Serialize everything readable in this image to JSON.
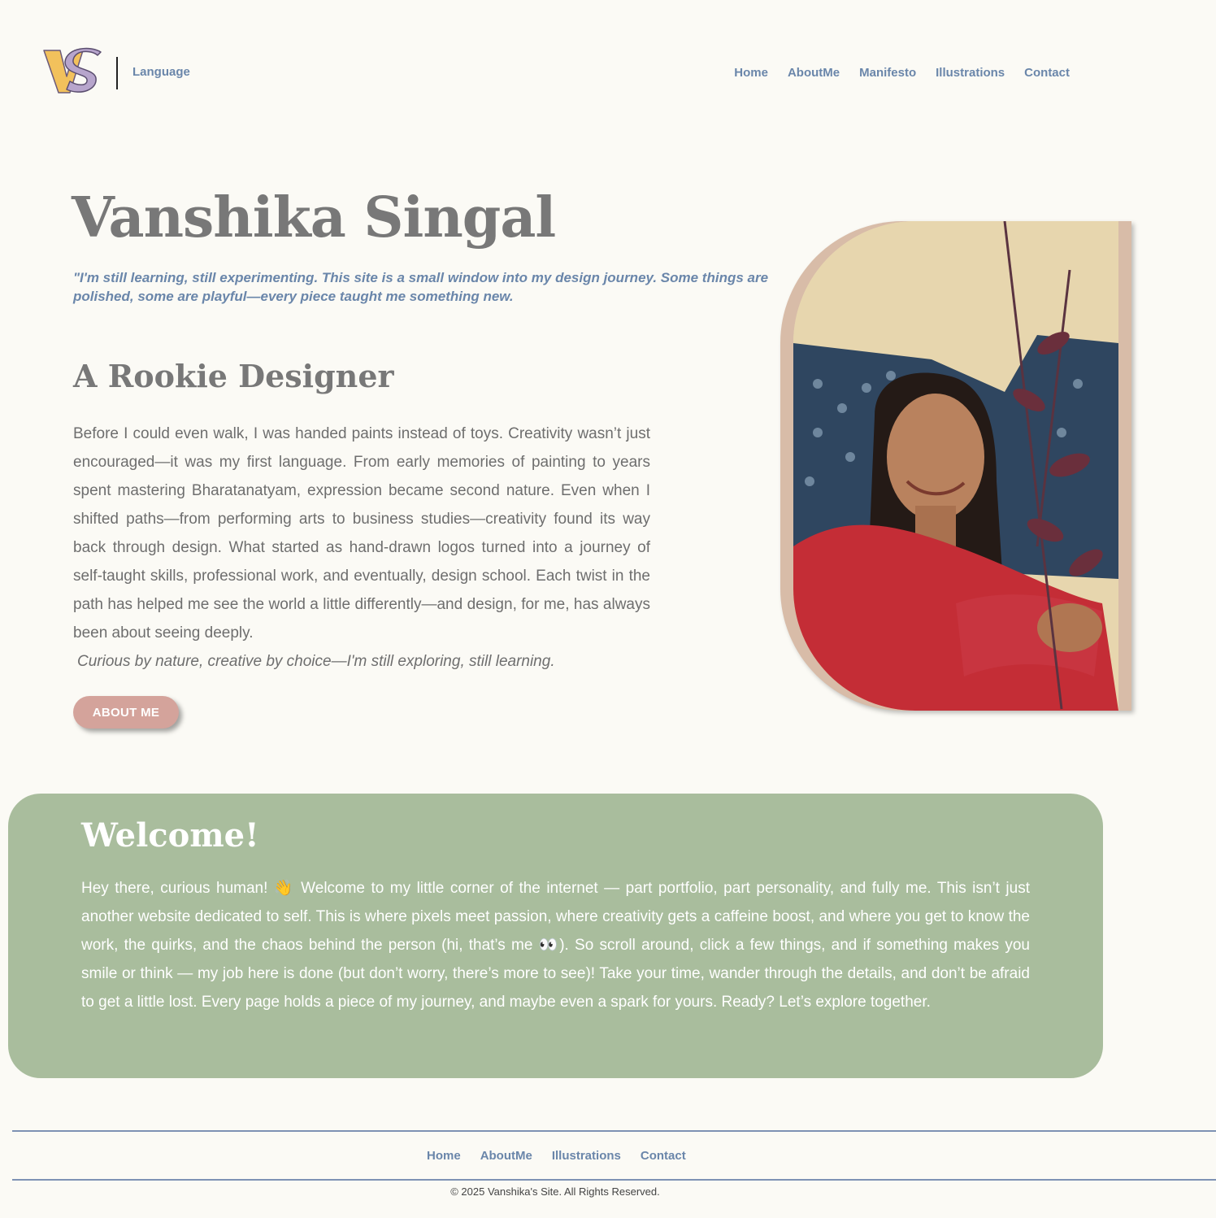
{
  "header": {
    "logo_text": "VS",
    "language_label": "Language",
    "nav": [
      "Home",
      "AboutMe",
      "Manifesto",
      "Illustrations",
      "Contact"
    ]
  },
  "hero": {
    "title": "Vanshika Singal",
    "quote": "\"I'm still learning, still experimenting. This site is a small window into my design journey. Some things are polished, some are playful—every piece taught me something new."
  },
  "rookie": {
    "title": "A Rookie Designer",
    "body": "Before I could even walk, I was handed paints instead of toys. Creativity wasn’t just encouraged—it was my first language. From early memories of painting to years spent mastering Bharatanatyam, expression became second nature. Even when I shifted paths—from performing arts to business studies—creativity found its way back through design. What started as hand-drawn logos turned into a journey of self-taught skills, professional work, and eventually, design school. Each twist in the path has helped me see the world a little differently—and design, for me, has always been about seeing deeply.",
    "italic": "Curious by nature, creative by choice—I'm still exploring, still learning.",
    "button": "ABOUT ME"
  },
  "welcome": {
    "title": "Welcome!",
    "body": "Hey there, curious human! 👋 Welcome to my little corner of the internet — part portfolio, part personality, and fully me. This isn’t just another website dedicated to self. This is where pixels meet passion, where creativity gets a caffeine boost, and where you get to know the work, the quirks, and the chaos behind the person (hi, that’s me 👀). So scroll around, click a few things, and if something makes you smile or think — my job here is done (but don’t worry, there’s more to see)! Take your time, wander through the details, and don’t be afraid to get a little lost. Every page holds a piece of my journey, and maybe even a spark for yours. Ready? Let’s explore together."
  },
  "footer": {
    "nav": [
      "Home",
      "AboutMe",
      "Illustrations",
      "Contact"
    ],
    "copyright": "© 2025 Vanshika's Site. All Rights Reserved."
  },
  "colors": {
    "background": "#fbfaf5",
    "accent_blue": "#6a86aa",
    "heading_gray": "#787878",
    "welcome_green": "#a9bd9d",
    "button_pink": "#d4a39b",
    "logo_yellow": "#f2c15c",
    "logo_purple": "#b7a5cc"
  }
}
